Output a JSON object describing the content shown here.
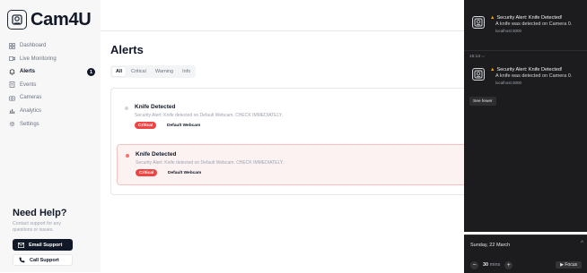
{
  "app": {
    "name": "Cam4U"
  },
  "sidebar": {
    "items": [
      {
        "label": "Dashboard",
        "icon": "grid-icon"
      },
      {
        "label": "Live Monitoring",
        "icon": "video-icon"
      },
      {
        "label": "Alerts",
        "icon": "bell-icon",
        "badge": "1",
        "active": true
      },
      {
        "label": "Events",
        "icon": "document-icon"
      },
      {
        "label": "Cameras",
        "icon": "camera-icon"
      },
      {
        "label": "Analytics",
        "icon": "chart-icon"
      },
      {
        "label": "Settings",
        "icon": "gear-icon"
      }
    ]
  },
  "help": {
    "title": "Need Help?",
    "description": "Contact support for any questions or issues.",
    "email_label": "Email Support",
    "call_label": "Call Support"
  },
  "main": {
    "title": "Alerts",
    "tabs": [
      {
        "label": "All",
        "active": true
      },
      {
        "label": "Critical"
      },
      {
        "label": "Warning"
      },
      {
        "label": "Info"
      }
    ],
    "alerts": [
      {
        "title": "Knife Detected",
        "message": "Security Alert: Knife detected on Default Webcam. CHECK IMMEDIATELY.",
        "severity": "Critical",
        "source": "Default Webcam",
        "highlighted": false
      },
      {
        "title": "Knife Detected",
        "message": "Security Alert: Knife detected on Default Webcam. CHECK IMMEDIATELY.",
        "severity": "Critical",
        "source": "Default Webcam",
        "highlighted": true
      }
    ]
  },
  "notifications": {
    "items": [
      {
        "title": "Security Alert: Knife Detected!",
        "body": "A knife was detected on Camera 0.",
        "host": "localhost:3000"
      },
      {
        "title": "Security Alert: Knife Detected!",
        "body": "A knife was detected on Camera 0.",
        "host": "localhost:3000"
      }
    ],
    "time_label": "15:13",
    "see_fewer_label": "See fewer"
  },
  "clock": {
    "date": "Sunday, 22 March",
    "focus_minutes": "30",
    "focus_unit": "mins",
    "focus_label": "Focus"
  },
  "colors": {
    "accent": "#111827",
    "critical": "#ef4444",
    "highlight_bg": "#fdf2f2",
    "warning": "#f59e0b"
  }
}
